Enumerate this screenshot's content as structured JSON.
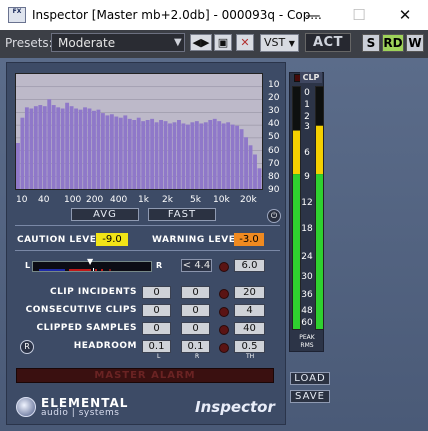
{
  "window": {
    "title": "Inspector [Master  mb+2.0db] - 000093q - Cop...",
    "app_icon_text": "FX"
  },
  "toolbar": {
    "presets_label": "Presets:",
    "preset_value": "Moderate",
    "vst_label": "VST",
    "act_label": "ACT",
    "s_label": "S",
    "rd_label": "RD",
    "w_label": "W",
    "colors": {
      "s": "#c9cdd6",
      "rd": "#9ed35a",
      "w": "#c9cdd6"
    }
  },
  "spectrum": {
    "db_scale": [
      "10",
      "20",
      "30",
      "40",
      "50",
      "60",
      "70",
      "80",
      "90"
    ],
    "freq_scale": [
      "10",
      "40",
      "100",
      "200",
      "400",
      "1k",
      "2k",
      "5k",
      "10k",
      "20k"
    ],
    "levels": [
      0.4,
      0.62,
      0.71,
      0.7,
      0.72,
      0.73,
      0.72,
      0.78,
      0.73,
      0.71,
      0.7,
      0.75,
      0.72,
      0.7,
      0.69,
      0.71,
      0.7,
      0.68,
      0.69,
      0.66,
      0.64,
      0.65,
      0.63,
      0.62,
      0.64,
      0.61,
      0.6,
      0.62,
      0.59,
      0.6,
      0.61,
      0.58,
      0.6,
      0.59,
      0.57,
      0.58,
      0.6,
      0.57,
      0.56,
      0.58,
      0.59,
      0.57,
      0.58,
      0.6,
      0.61,
      0.59,
      0.57,
      0.58,
      0.56,
      0.55,
      0.52,
      0.45,
      0.38,
      0.3,
      0.18
    ],
    "avg_label": "AVG",
    "fast_label": "FAST"
  },
  "thresholds": {
    "caution_label": "CAUTION LEVEL",
    "caution_value": "-9.0",
    "warning_label": "WARNING LEVEL",
    "warning_value": "-3.0"
  },
  "balance": {
    "left_label": "L",
    "right_label": "R",
    "indicator": "< 4.4",
    "value": "6.0"
  },
  "stats": {
    "rows": [
      {
        "label": "CLIP INCIDENTS",
        "l": "0",
        "r": "0",
        "th": "20"
      },
      {
        "label": "CONSECUTIVE CLIPS",
        "l": "0",
        "r": "0",
        "th": "4"
      },
      {
        "label": "CLIPPED SAMPLES",
        "l": "0",
        "r": "0",
        "th": "40"
      },
      {
        "label": "HEADROOM",
        "l": "0.1",
        "r": "0.1",
        "th": "0.5"
      }
    ],
    "col_l": "L",
    "col_r": "R",
    "col_th": "TH",
    "reset_label": "R"
  },
  "alarm": {
    "label": "MASTER ALARM"
  },
  "meter": {
    "clp_label": "CLP",
    "scale": [
      "0",
      "1",
      "2",
      "3",
      "6",
      "9",
      "12",
      "18",
      "24",
      "30",
      "36",
      "48",
      "60"
    ],
    "peak_label": "PEAK",
    "rms_label": "RMS",
    "left_level": 0.82,
    "right_level": 0.84
  },
  "buttons": {
    "load": "LOAD",
    "save": "SAVE"
  },
  "brand": {
    "name": "ELEMENTAL",
    "sub": "audio | systems",
    "product": "Inspector"
  }
}
